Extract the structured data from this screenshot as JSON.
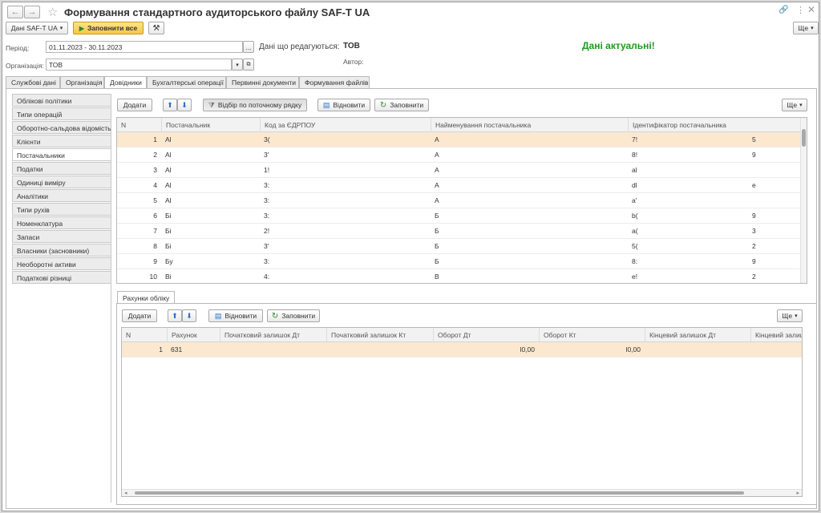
{
  "title": "Формування стандартного аудиторського файлу SAF-T UA",
  "toolbar": {
    "data_menu": "Дані SAF-T UA",
    "fill_all": "Заповнити все",
    "more": "Ще"
  },
  "form": {
    "period_label": "Період:",
    "period_value": "01.11.2023 - 30.11.2023",
    "period_btn": "...",
    "edited_label": "Дані що редагуються:",
    "edited_value": "ТОВ",
    "author_label": "Автор:",
    "org_label": "Організація:",
    "org_value": "ТОВ",
    "status": "Дані актуальні!"
  },
  "tabs": [
    "Службові дані",
    "Організація",
    "Довідники",
    "Бухгалтерські операції",
    "Первинні документи",
    "Формування файлів"
  ],
  "sidebar": [
    "Облікові політики",
    "Типи операцій",
    "Оборотно-сальдова відомість",
    "Клієнти",
    "Постачальники",
    "Податки",
    "Одиниці виміру",
    "Аналітики",
    "Типи рухів",
    "Номенклатура",
    "Запаси",
    "Власники (засновники)",
    "Необоротні активи",
    "Податкові різниці"
  ],
  "upper": {
    "add": "Додати",
    "filter": "Відбір по поточному рядку",
    "refresh": "Відновити",
    "fill": "Заповнити",
    "more": "Ще",
    "columns": [
      "N",
      "Постачальник",
      "Код за ЄДРПОУ",
      "Найменування постачальника",
      "Ідентифікатор постачальника"
    ],
    "rows": [
      [
        "1",
        "Al",
        "3(",
        "А",
        "7!",
        "5"
      ],
      [
        "2",
        "Al",
        "3'",
        "А",
        "8!",
        "9"
      ],
      [
        "3",
        "Al",
        "1!",
        "А",
        "al",
        ""
      ],
      [
        "4",
        "Al",
        "3:",
        "А",
        "dl",
        "e"
      ],
      [
        "5",
        "Al",
        "3:",
        "А",
        "a'",
        ""
      ],
      [
        "6",
        "Бі",
        "3:",
        "Б",
        "b(",
        "9"
      ],
      [
        "7",
        "Бі",
        "2!",
        "Б",
        "a(",
        "3"
      ],
      [
        "8",
        "Бі",
        "3'",
        "Б",
        "5(",
        "2"
      ],
      [
        "9",
        "Бу",
        "3:",
        "Б",
        "8:",
        "9"
      ],
      [
        "10",
        "Ві",
        "4:",
        "В",
        "e!",
        "2"
      ]
    ]
  },
  "lower": {
    "tab": "Рахунки обліку",
    "add": "Додати",
    "refresh": "Відновити",
    "fill": "Заповнити",
    "more": "Ще",
    "columns": [
      "N",
      "Рахунок",
      "Початковий залишок Дт",
      "Початковий залишок Кт",
      "Оборот Дт",
      "Оборот Кт",
      "Кінцевий залишок Дт",
      "Кінцевий залиш"
    ],
    "rows": [
      [
        "1",
        "631",
        "",
        "",
        "l0,00",
        "l0,00",
        "",
        ""
      ]
    ]
  }
}
